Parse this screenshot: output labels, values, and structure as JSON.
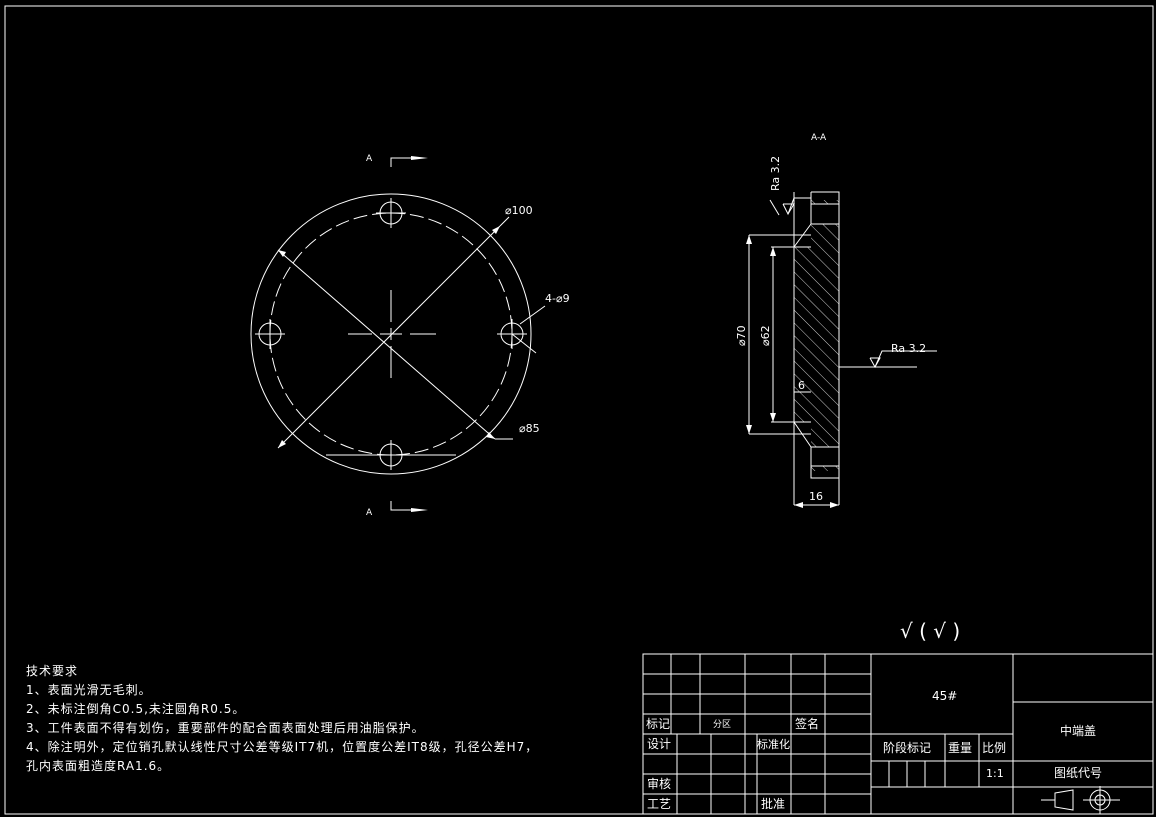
{
  "section_label": "A-A",
  "cut_marks": {
    "top": "A",
    "bottom": "A"
  },
  "front_view": {
    "dim_outer": "⌀100",
    "dim_holes": "4-⌀9",
    "dim_pcd": "⌀85"
  },
  "section_view": {
    "roughness_left": "Ra 3.2",
    "roughness_right": "Ra 3.2",
    "dim_outer_bore": "⌀70",
    "dim_inner_bore": "⌀62",
    "dim_depth": "6",
    "dim_thickness": "16"
  },
  "surface_finish_note": "√ ( √ )",
  "tech_requirements": {
    "title": "技术要求",
    "lines": [
      "1、表面光滑无毛刺。",
      "2、未标注倒角C0.5,未注圆角R0.5。",
      "3、工件表面不得有划伤，重要部件的配合面表面处理后用油脂保护。",
      "4、除注明外，定位销孔默认线性尺寸公差等级IT7机，位置度公差IT8级，孔径公差H7，",
      "孔内表面粗造度RA1.6。"
    ]
  },
  "title_block": {
    "material": "45#",
    "part_name": "中端盖",
    "drawing_no_label": "图纸代号",
    "mark": "标记",
    "zone": "分区",
    "signature": "签名",
    "design": "设计",
    "standardization": "标准化",
    "stage_mark": "阶段标记",
    "weight": "重量",
    "scale_label": "比例",
    "scale_value": "1:1",
    "review": "审核",
    "process": "工艺",
    "approve": "批准"
  }
}
